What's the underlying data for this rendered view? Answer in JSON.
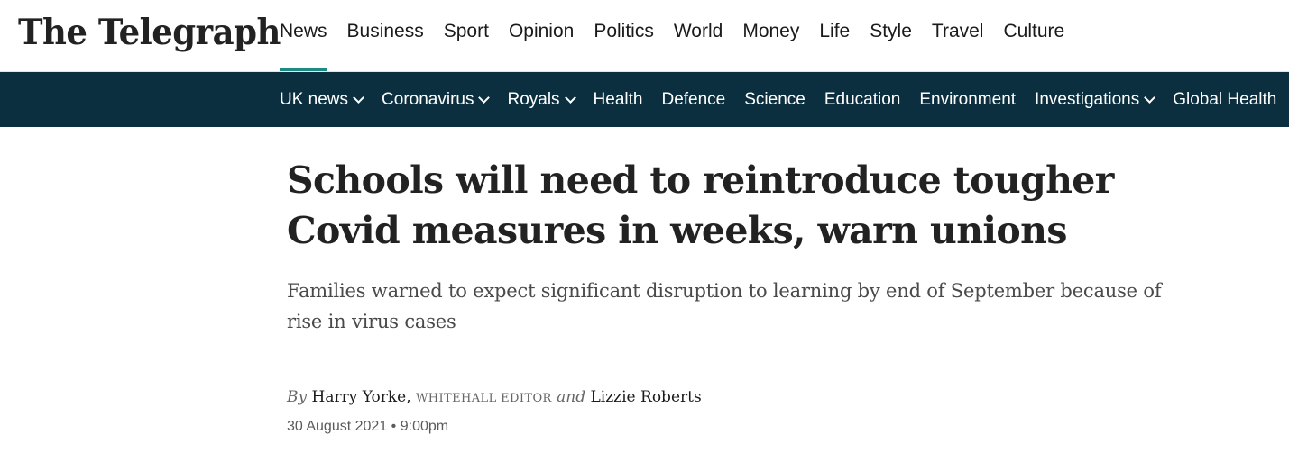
{
  "brand": {
    "logo_text": "The Telegraph"
  },
  "primary_nav": {
    "items": [
      "News",
      "Business",
      "Sport",
      "Opinion",
      "Politics",
      "World",
      "Money",
      "Life",
      "Style",
      "Travel",
      "Culture"
    ],
    "active": "News",
    "accent_color": "#1d8a86"
  },
  "secondary_nav": {
    "background_color": "#0b2f3f",
    "items": [
      {
        "label": "UK news",
        "has_dropdown": true
      },
      {
        "label": "Coronavirus",
        "has_dropdown": true
      },
      {
        "label": "Royals",
        "has_dropdown": true
      },
      {
        "label": "Health",
        "has_dropdown": false
      },
      {
        "label": "Defence",
        "has_dropdown": false
      },
      {
        "label": "Science",
        "has_dropdown": false
      },
      {
        "label": "Education",
        "has_dropdown": false
      },
      {
        "label": "Environment",
        "has_dropdown": false
      },
      {
        "label": "Investigations",
        "has_dropdown": true
      },
      {
        "label": "Global Health",
        "has_dropdown": false
      }
    ]
  },
  "article": {
    "headline": "Schools will need to reintroduce tougher Covid measures in weeks, warn unions",
    "standfirst": "Families warned to expect significant disruption to learning by end of September because of rise in virus cases",
    "byline": {
      "by": "By",
      "author1": "Harry Yorke,",
      "author1_role": "WHITEHALL EDITOR",
      "and": "and",
      "author2": "Lizzie Roberts"
    },
    "date": "30 August 2021",
    "separator": "•",
    "time": "9:00pm"
  }
}
